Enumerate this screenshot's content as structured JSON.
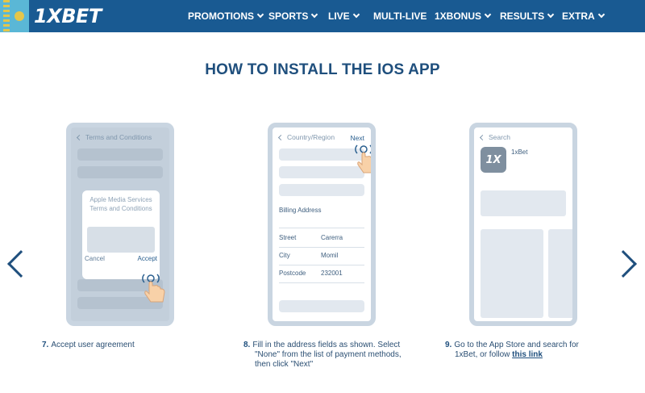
{
  "header": {
    "logo_prefix": "1X",
    "logo_suffix": "BET",
    "nav": [
      {
        "label": "PROMOTIONS",
        "dropdown": true
      },
      {
        "label": "SPORTS",
        "dropdown": true
      },
      {
        "label": "LIVE",
        "dropdown": true
      },
      {
        "label": "MULTI-LIVE",
        "dropdown": false
      },
      {
        "label": "1XBONUS",
        "dropdown": true
      },
      {
        "label": "RESULTS",
        "dropdown": true
      },
      {
        "label": "EXTRA",
        "dropdown": true
      }
    ],
    "bg_color": "#195a92"
  },
  "page_title": "HOW TO INSTALL THE IOS APP",
  "phones": [
    {
      "back_label": "Terms and Conditions",
      "dialog_title": "Apple Media Services Terms and Conditions",
      "cancel": "Cancel",
      "accept": "Accept"
    },
    {
      "back_label": "Country/Region",
      "next": "Next",
      "billing": "Billing Address",
      "rows": [
        {
          "label": "Street",
          "value": "Carerra"
        },
        {
          "label": "City",
          "value": "Momil"
        },
        {
          "label": "Postcode",
          "value": "232001"
        }
      ]
    },
    {
      "back_label": "Search",
      "app_icon_text": "1X",
      "app_name": "1xBet"
    }
  ],
  "steps": [
    {
      "num": "7.",
      "text": "Accept user agreement"
    },
    {
      "num": "8.",
      "text": "Fill in the address fields as shown. Select \"None\" from the list of payment methods, then click \"Next\""
    },
    {
      "num": "9.",
      "text": "Go to the App Store and search for 1xBet, or follow",
      "link": "this link"
    }
  ],
  "icons": {
    "prev": "chevron-left-icon",
    "next": "chevron-right-icon",
    "tap": "tap-hand-icon"
  }
}
